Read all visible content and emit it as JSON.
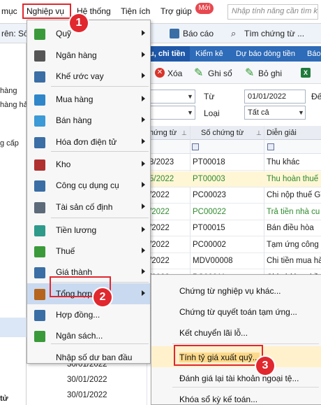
{
  "menubar": {
    "items": [
      "mục",
      "Nghiệp vụ",
      "Hệ thống",
      "Tiện ích",
      "Trợ giúp"
    ],
    "badge": "Mới",
    "search_placeholder": "Nhập tính năng cần tìm kiếm"
  },
  "row2": {
    "left_text": "rên: Số",
    "report_label": "Báo cáo",
    "find_label": "Tìm chứng từ ..."
  },
  "left_pane": {
    "items": [
      "hàng",
      "hàng hả",
      "g cấp"
    ],
    "bottom_label": "tử"
  },
  "tabs": [
    "u, chi tiền",
    "Kiểm kê",
    "Dự báo dòng tiền",
    "Báo"
  ],
  "actions": {
    "delete": "Xóa",
    "record": "Ghi sổ",
    "unrecord": "Bỏ ghi"
  },
  "filter": {
    "from_label": "Từ",
    "to_label": "Đế",
    "from_date": "01/01/2022",
    "type_label": "Loại",
    "type_value": "Tất cả"
  },
  "grid": {
    "headers": [
      "hứng từ",
      "Số chứng từ",
      "Diễn giải"
    ],
    "rows": [
      {
        "date": "8/2023",
        "doc": "PT00018",
        "desc": "Thu khác",
        "color": "#222"
      },
      {
        "date": "5/2022",
        "doc": "PT00003",
        "desc": "Thu hoàn thuế G",
        "color": "#2e8b2e"
      },
      {
        "date": "/2022",
        "doc": "PC00023",
        "desc": "Chi nộp thuế GT",
        "color": "#222"
      },
      {
        "date": "/2022",
        "doc": "PC00022",
        "desc": "Trả tiền nhà cu",
        "color": "#2e8b2e"
      },
      {
        "date": "/2022",
        "doc": "PT00015",
        "desc": "Bán điều hòa",
        "color": "#222"
      },
      {
        "date": "/2022",
        "doc": "PC00002",
        "desc": "Tạm ứng công t",
        "color": "#222"
      },
      {
        "date": "/2022",
        "doc": "MDV00008",
        "desc": "Chi tiền mua hà",
        "color": "#222"
      },
      {
        "date": "/2022",
        "doc": "PC00011",
        "desc": "Chi phí hoa hồn",
        "color": "#222"
      }
    ],
    "bottom_dates": [
      "30/01/2022",
      "30/01/2022",
      "30/01/2022"
    ]
  },
  "menu1": {
    "items": [
      {
        "label": "Quỹ",
        "icon": "cash-icon",
        "arrow": true,
        "color": "#3a9a3a"
      },
      {
        "label": "Ngân hàng",
        "icon": "bank-icon",
        "arrow": true,
        "color": "#555555"
      },
      {
        "label": "Khế ước vay",
        "icon": "contract-icon",
        "arrow": true,
        "color": "#3a6ea5"
      },
      {
        "label": "Mua hàng",
        "icon": "purchase-icon",
        "arrow": true,
        "color": "#2f86c9"
      },
      {
        "label": "Bán hàng",
        "icon": "sales-icon",
        "arrow": true,
        "color": "#3c9ad6"
      },
      {
        "label": "Hóa đơn điện tử",
        "icon": "e-invoice-icon",
        "arrow": true,
        "color": "#3a6ea5"
      },
      {
        "label": "Kho",
        "icon": "warehouse-icon",
        "arrow": true,
        "color": "#b03030"
      },
      {
        "label": "Công cụ dụng cụ",
        "icon": "tools-icon",
        "arrow": true,
        "color": "#3a6ea5"
      },
      {
        "label": "Tài sản cố định",
        "icon": "asset-icon",
        "arrow": true,
        "color": "#5c6a7a"
      },
      {
        "label": "Tiền lương",
        "icon": "salary-icon",
        "arrow": true,
        "color": "#2e9a8a"
      },
      {
        "label": "Thuế",
        "icon": "tax-icon",
        "arrow": true,
        "color": "#3a9a3a"
      },
      {
        "label": "Giá thành",
        "icon": "cost-icon",
        "arrow": true,
        "color": "#3a6ea5"
      },
      {
        "label": "Tổng hợp",
        "icon": "general-icon",
        "arrow": true,
        "color": "#b5651d"
      },
      {
        "label": "Hợp đồng...",
        "icon": "agreement-icon",
        "arrow": false,
        "color": "#3a6ea5"
      },
      {
        "label": "Ngân sách...",
        "icon": "budget-icon",
        "arrow": false,
        "color": "#3a9a3a"
      },
      {
        "label": "Nhập số dư ban đầu",
        "icon": "",
        "arrow": false,
        "color": ""
      }
    ]
  },
  "menu2": {
    "items": [
      "Chứng từ nghiệp vụ khác...",
      "Chứng từ quyết toán tạm ứng...",
      "Kết chuyển lãi lỗ...",
      "Tính tỷ giá xuất quỹ...",
      "Đánh giá lại tài khoản ngoại tệ...",
      "Khóa sổ kỳ kế toán..."
    ]
  },
  "steps": [
    "1",
    "2",
    "3"
  ]
}
